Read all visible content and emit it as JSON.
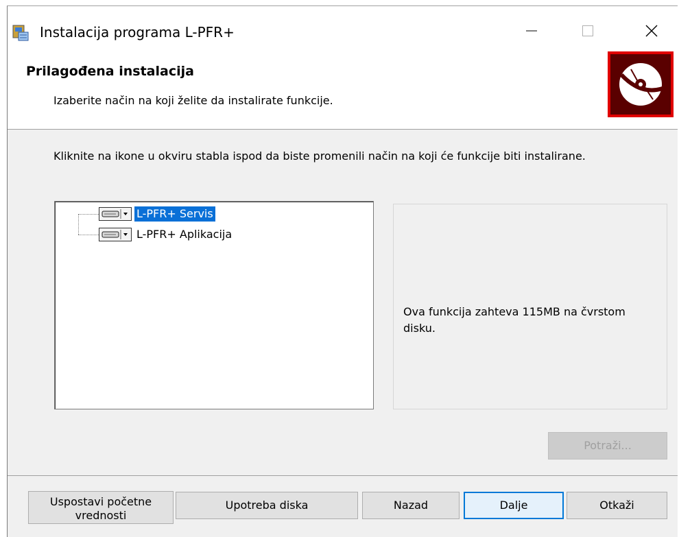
{
  "window": {
    "title": "Instalacija programa L-PFR+"
  },
  "header": {
    "title": "Prilagođena instalacija",
    "subtitle": "Izaberite način na koji želite da instalirate funkcije."
  },
  "instructions": "Kliknite na ikone u okviru stabla ispod da biste promenili način na koji će funkcije biti instalirane.",
  "tree": {
    "items": [
      {
        "label": "L-PFR+ Servis",
        "selected": true
      },
      {
        "label": "L-PFR+ Aplikacija",
        "selected": false
      }
    ]
  },
  "description": "Ova funkcija zahteva 115MB na čvrstom disku.",
  "buttons": {
    "browse": "Potraži...",
    "reset": "Uspostavi početne vrednosti",
    "disk_usage": "Upotreba diska",
    "back": "Nazad",
    "next": "Dalje",
    "cancel": "Otkaži"
  },
  "colors": {
    "selection": "#0a70d7",
    "logo_background": "#e00000",
    "default_button_border": "#0078d7"
  }
}
